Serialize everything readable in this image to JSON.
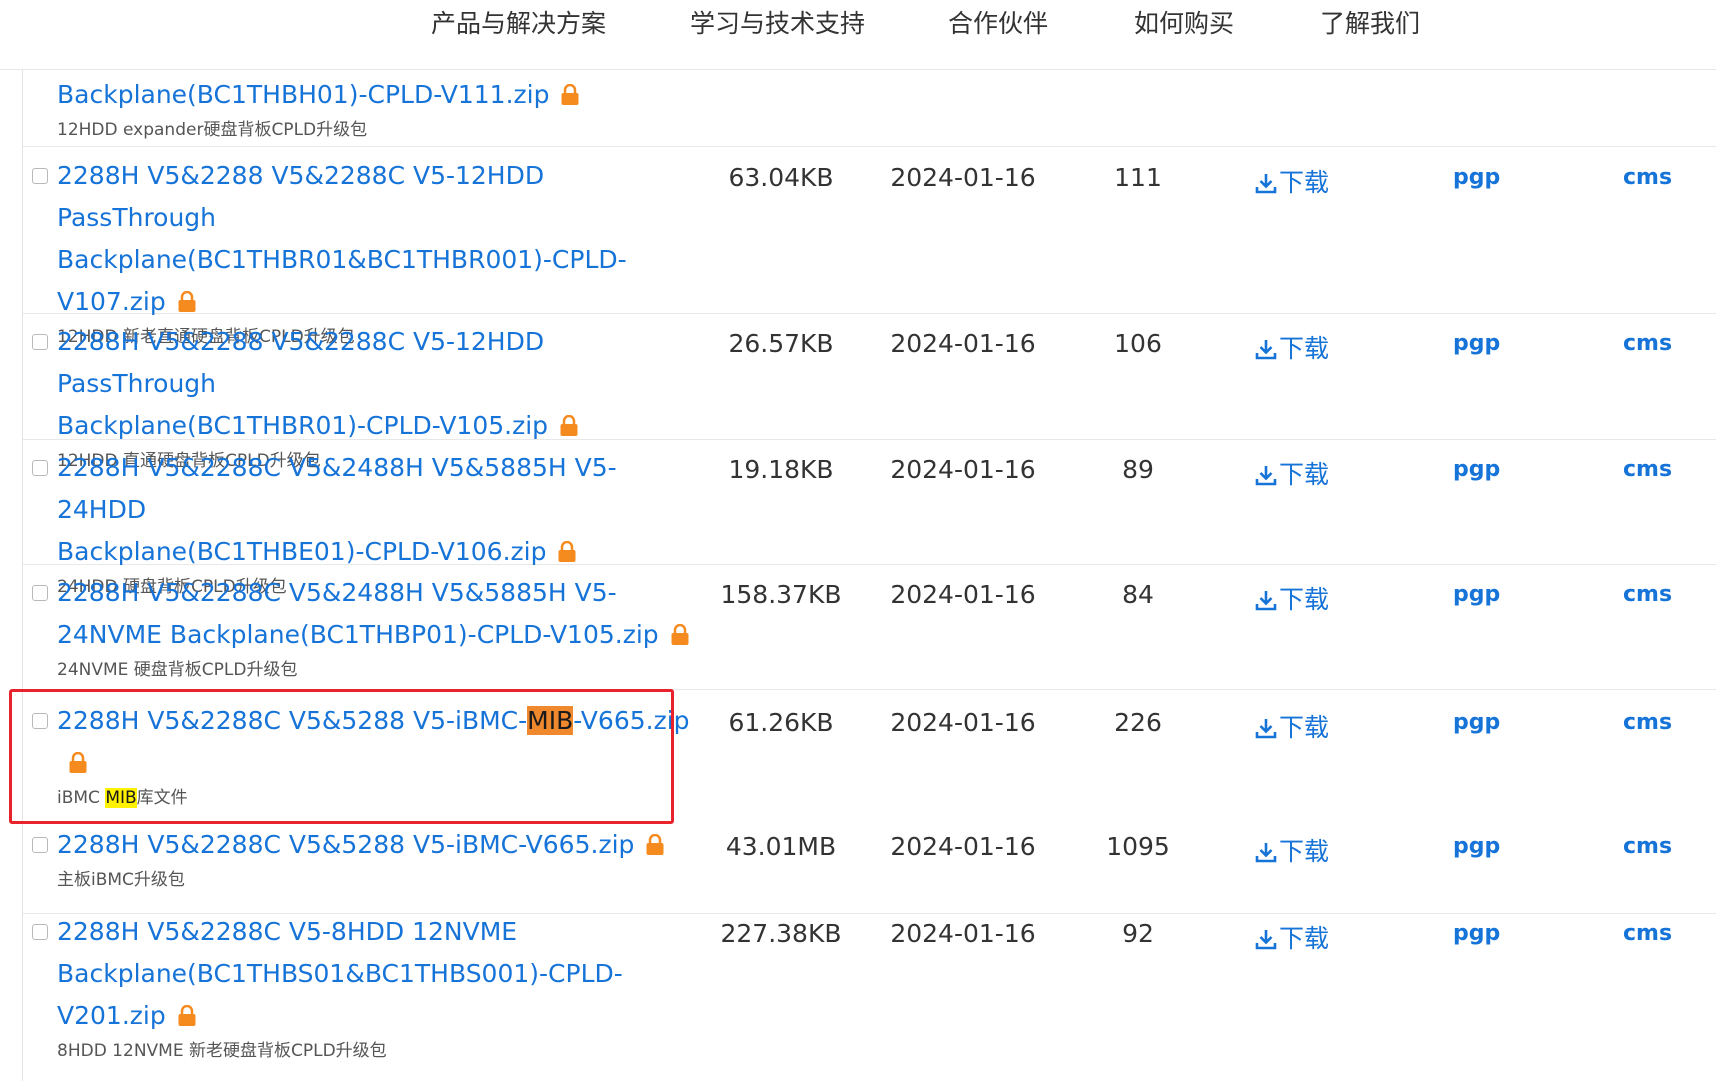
{
  "nav": [
    "产品与解决方案",
    "学习与技术支持",
    "合作伙伴",
    "如何购买",
    "了解我们"
  ],
  "colors": {
    "link": "#1673d8",
    "lock": "#f58a1f",
    "highlight_name": "#f0882d",
    "highlight_desc": "#fff200",
    "annotation_box": "#e8232c"
  },
  "rows": [
    {
      "name_lines": [
        "Backplane(BC1THBH01)-CPLD-V111.zip"
      ],
      "desc": "12HDD expander硬盘背板CPLD升级包"
    },
    {
      "name_lines": [
        "2288H V5&2288 V5&2288C V5-12HDD PassThrough",
        "Backplane(BC1THBR01&BC1THBR001)-CPLD-",
        "V107.zip"
      ],
      "desc": "12HDD 新老直通硬盘背板CPLD升级包",
      "size": "63.04KB",
      "date": "2024-01-16",
      "downloads": "111",
      "download_label": "下载",
      "pgp": "pgp",
      "cms": "cms"
    },
    {
      "name_lines": [
        "2288H V5&2288 V5&2288C V5-12HDD PassThrough",
        "Backplane(BC1THBR01)-CPLD-V105.zip"
      ],
      "desc": "12HDD 直通硬盘背板CPLD升级包",
      "size": "26.57KB",
      "date": "2024-01-16",
      "downloads": "106",
      "download_label": "下载",
      "pgp": "pgp",
      "cms": "cms"
    },
    {
      "name_lines": [
        "2288H V5&2288C V5&2488H V5&5885H V5-24HDD",
        "Backplane(BC1THBE01)-CPLD-V106.zip"
      ],
      "desc": "24HDD 硬盘背板CPLD升级包",
      "size": "19.18KB",
      "date": "2024-01-16",
      "downloads": "89",
      "download_label": "下载",
      "pgp": "pgp",
      "cms": "cms"
    },
    {
      "name_lines": [
        "2288H V5&2288C V5&2488H V5&5885H V5-",
        "24NVME Backplane(BC1THBP01)-CPLD-V105.zip"
      ],
      "desc": "24NVME 硬盘背板CPLD升级包",
      "size": "158.37KB",
      "date": "2024-01-16",
      "downloads": "84",
      "download_label": "下载",
      "pgp": "pgp",
      "cms": "cms"
    },
    {
      "name_pre": "2288H V5&2288C V5&5288 V5-iBMC-",
      "name_hl": "MIB",
      "name_post": "-V665.zip",
      "desc_pre": "iBMC ",
      "desc_hl": "MIB",
      "desc_post": "库文件",
      "size": "61.26KB",
      "date": "2024-01-16",
      "downloads": "226",
      "download_label": "下载",
      "pgp": "pgp",
      "cms": "cms"
    },
    {
      "name_lines": [
        "2288H V5&2288C V5&5288 V5-iBMC-V665.zip"
      ],
      "desc": "主板iBMC升级包",
      "size": "43.01MB",
      "date": "2024-01-16",
      "downloads": "1095",
      "download_label": "下载",
      "pgp": "pgp",
      "cms": "cms"
    },
    {
      "name_lines": [
        "2288H V5&2288C V5-8HDD 12NVME",
        "Backplane(BC1THBS01&BC1THBS001)-CPLD-",
        "V201.zip"
      ],
      "desc": "8HDD 12NVME 新老硬盘背板CPLD升级包",
      "size": "227.38KB",
      "date": "2024-01-16",
      "downloads": "92",
      "download_label": "下载",
      "pgp": "pgp",
      "cms": "cms"
    }
  ]
}
